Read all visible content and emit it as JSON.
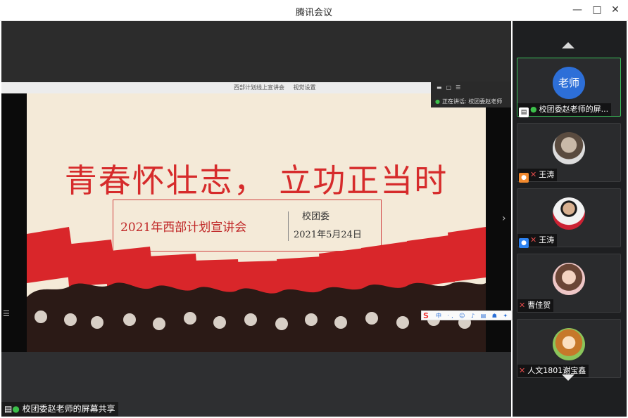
{
  "window": {
    "title": "腾讯会议",
    "minimize_icon": "minimize-icon",
    "maximize_icon": "maximize-icon",
    "close_icon": "close-icon"
  },
  "shared_screen": {
    "browser_tabs": [
      "西部计划线上宣讲会",
      "视觉设置"
    ],
    "speaking_text": "正在讲话: 校团委赵老师",
    "slide": {
      "title": "青春怀壮志， 立功正当时",
      "subtitle": "2021年西部计划宣讲会",
      "organizer": "校团委",
      "date": "2021年5月24日"
    },
    "ime_bar_text": "中 ·, ☺ ♪ ▤ ☗ ✦ ⊞",
    "ime_logo": "S"
  },
  "share_label": "校团委赵老师的屏幕共享",
  "participants": [
    {
      "name": "校团委赵老师的屏...",
      "avatar_text": "老师",
      "mic": "on",
      "badge": "screen"
    },
    {
      "name": "王涛",
      "mic": "off",
      "badge": "orange"
    },
    {
      "name": "王涛",
      "mic": "off",
      "badge": "blue"
    },
    {
      "name": "曹佳贺",
      "mic": "off",
      "badge": ""
    },
    {
      "name": "人文1801谢宝鑫",
      "mic": "off",
      "badge": ""
    }
  ],
  "colors": {
    "accent_green": "#3bbf5a",
    "slide_red": "#d62b2b",
    "avatar_blue": "#2d6fd8"
  }
}
